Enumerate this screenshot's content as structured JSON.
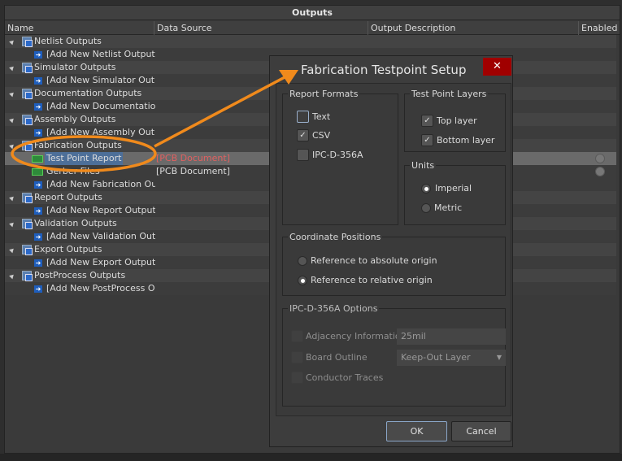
{
  "panel": {
    "title": "Outputs",
    "columns": [
      "Name",
      "Data Source",
      "Output Description",
      "Enabled"
    ]
  },
  "rows": [
    {
      "type": "group",
      "name": "Netlist Outputs"
    },
    {
      "type": "add",
      "name": "[Add New Netlist Output]"
    },
    {
      "type": "group",
      "name": "Simulator Outputs"
    },
    {
      "type": "add",
      "name": "[Add New Simulator Output]"
    },
    {
      "type": "group",
      "name": "Documentation Outputs"
    },
    {
      "type": "add",
      "name": "[Add New Documentation Output]"
    },
    {
      "type": "group",
      "name": "Assembly Outputs"
    },
    {
      "type": "add",
      "name": "[Add New Assembly Output]"
    },
    {
      "type": "group",
      "name": "Fabrication Outputs"
    },
    {
      "type": "item",
      "name": "Test Point Report",
      "source": "[PCB Document]",
      "selected": true,
      "enabled": true
    },
    {
      "type": "item",
      "name": "Gerber Files",
      "source": "[PCB Document]",
      "enabled": true
    },
    {
      "type": "add",
      "name": "[Add New Fabrication Output]"
    },
    {
      "type": "group",
      "name": "Report Outputs"
    },
    {
      "type": "add",
      "name": "[Add New Report Output]"
    },
    {
      "type": "group",
      "name": "Validation Outputs"
    },
    {
      "type": "add",
      "name": "[Add New Validation Output]"
    },
    {
      "type": "group",
      "name": "Export Outputs"
    },
    {
      "type": "add",
      "name": "[Add New Export Output]"
    },
    {
      "type": "group",
      "name": "PostProcess Outputs"
    },
    {
      "type": "add",
      "name": "[Add New PostProcess Output]"
    }
  ],
  "dialog": {
    "title": "Fabrication Testpoint Setup",
    "close": "✕",
    "report_formats": {
      "label": "Report Formats",
      "options": [
        {
          "label": "Text",
          "checked": false
        },
        {
          "label": "CSV",
          "checked": true
        },
        {
          "label": "IPC-D-356A",
          "checked": false
        }
      ]
    },
    "layers": {
      "label": "Test Point Layers",
      "options": [
        {
          "label": "Top layer",
          "checked": true
        },
        {
          "label": "Bottom layer",
          "checked": true
        }
      ]
    },
    "units": {
      "label": "Units",
      "options": [
        {
          "label": "Imperial",
          "selected": true
        },
        {
          "label": "Metric",
          "selected": false
        }
      ]
    },
    "coords": {
      "label": "Coordinate Positions",
      "options": [
        {
          "label": "Reference to absolute origin",
          "selected": false
        },
        {
          "label": "Reference to relative origin",
          "selected": true
        }
      ]
    },
    "ipc": {
      "label": "IPC-D-356A Options",
      "adjacency": "Adjacency Information",
      "adjacency_value": "25mil",
      "board_outline": "Board Outline",
      "board_outline_value": "Keep-Out Layer",
      "conductor": "Conductor Traces"
    },
    "ok": "OK",
    "cancel": "Cancel"
  },
  "colors": {
    "highlight": "#f08a1c",
    "selection": "#4d6f99",
    "close": "#a00000"
  }
}
